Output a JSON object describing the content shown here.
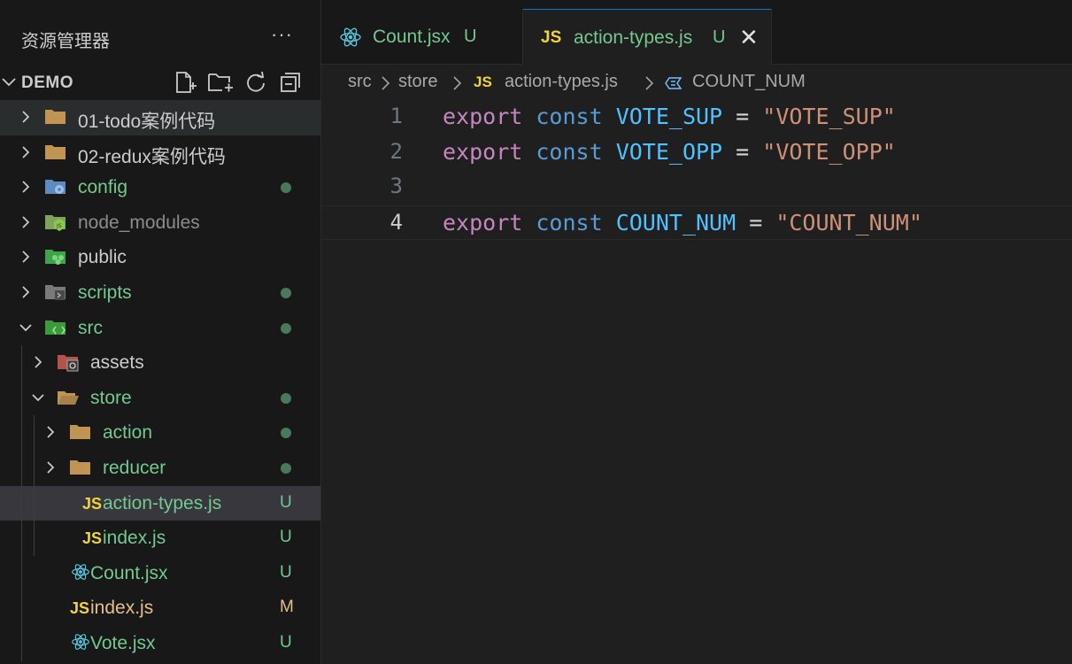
{
  "explorer": {
    "title": "资源管理器",
    "more": "···",
    "root_label": "DEMO",
    "actions": [
      "new-file-icon",
      "new-folder-icon",
      "refresh-icon",
      "collapse-all-icon"
    ]
  },
  "tree": [
    {
      "label": "01-todo案例代码",
      "type": "folder",
      "depth": 0,
      "expanded": false,
      "color": "#cccccc",
      "icon": "folder-icon",
      "status": ""
    },
    {
      "label": "02-redux案例代码",
      "type": "folder",
      "depth": 0,
      "expanded": false,
      "color": "#cccccc",
      "icon": "folder-icon",
      "status": ""
    },
    {
      "label": "config",
      "type": "folder",
      "depth": 0,
      "expanded": false,
      "color": "#73c991",
      "icon": "config-folder-icon",
      "status": "dot"
    },
    {
      "label": "node_modules",
      "type": "folder",
      "depth": 0,
      "expanded": false,
      "color": "#8c8c8c",
      "icon": "node-folder-icon",
      "status": ""
    },
    {
      "label": "public",
      "type": "folder",
      "depth": 0,
      "expanded": false,
      "color": "#cccccc",
      "icon": "public-folder-icon",
      "status": ""
    },
    {
      "label": "scripts",
      "type": "folder",
      "depth": 0,
      "expanded": false,
      "color": "#73c991",
      "icon": "scripts-folder-icon",
      "status": "dot"
    },
    {
      "label": "src",
      "type": "folder",
      "depth": 0,
      "expanded": true,
      "color": "#73c991",
      "icon": "src-folder-icon",
      "status": "dot"
    },
    {
      "label": "assets",
      "type": "folder",
      "depth": 1,
      "expanded": false,
      "color": "#cccccc",
      "icon": "assets-folder-icon",
      "status": ""
    },
    {
      "label": "store",
      "type": "folder",
      "depth": 1,
      "expanded": true,
      "color": "#73c991",
      "icon": "folder-open-icon",
      "status": "dot"
    },
    {
      "label": "action",
      "type": "folder",
      "depth": 2,
      "expanded": false,
      "color": "#73c991",
      "icon": "folder-icon",
      "status": "dot"
    },
    {
      "label": "reducer",
      "type": "folder",
      "depth": 2,
      "expanded": false,
      "color": "#73c991",
      "icon": "folder-icon",
      "status": "dot"
    },
    {
      "label": "action-types.js",
      "type": "js",
      "depth": 2,
      "color": "#73c991",
      "icon": "js-file-icon",
      "status": "U",
      "selected": true
    },
    {
      "label": "index.js",
      "type": "js",
      "depth": 2,
      "color": "#73c991",
      "icon": "js-file-icon",
      "status": "U"
    },
    {
      "label": "Count.jsx",
      "type": "react",
      "depth": 1,
      "color": "#73c991",
      "icon": "react-icon",
      "status": "U"
    },
    {
      "label": "index.js",
      "type": "js",
      "depth": 1,
      "color": "#e2c08d",
      "icon": "js-file-icon",
      "status": "M"
    },
    {
      "label": "Vote.jsx",
      "type": "react",
      "depth": 1,
      "color": "#73c991",
      "icon": "react-icon",
      "status": "U"
    }
  ],
  "tabs": [
    {
      "label": "Count.jsx",
      "status": "U",
      "icon": "react-icon"
    },
    {
      "label": "action-types.js",
      "status": "U",
      "icon": "js-file-icon",
      "active": true,
      "close": "✕"
    }
  ],
  "js_glyph": "JS",
  "breadcrumb": [
    "src",
    "store",
    "action-types.js",
    "COUNT_NUM"
  ],
  "code_lines": [
    {
      "num": "1",
      "tokens": [
        [
          "kw1",
          "export"
        ],
        [
          "op",
          " "
        ],
        [
          "kw2",
          "const"
        ],
        [
          "op",
          " "
        ],
        [
          "id",
          "VOTE_SUP"
        ],
        [
          "op",
          " = "
        ],
        [
          "str",
          "\"VOTE_SUP\""
        ]
      ]
    },
    {
      "num": "2",
      "tokens": [
        [
          "kw1",
          "export"
        ],
        [
          "op",
          " "
        ],
        [
          "kw2",
          "const"
        ],
        [
          "op",
          " "
        ],
        [
          "id",
          "VOTE_OPP"
        ],
        [
          "op",
          " = "
        ],
        [
          "str",
          "\"VOTE_OPP\""
        ]
      ]
    },
    {
      "num": "3",
      "tokens": []
    },
    {
      "num": "4",
      "current": true,
      "tokens": [
        [
          "kw1",
          "export"
        ],
        [
          "op",
          " "
        ],
        [
          "kw2",
          "const"
        ],
        [
          "op",
          " "
        ],
        [
          "id",
          "COUNT_NUM"
        ],
        [
          "op",
          " = "
        ],
        [
          "str",
          "\"COUNT_NUM\""
        ]
      ]
    }
  ],
  "colors": {
    "accent": "#0078d4",
    "untracked": "#73c991",
    "modified": "#e2c08d",
    "js": "#f0d43b",
    "react": "#58c4dc"
  }
}
